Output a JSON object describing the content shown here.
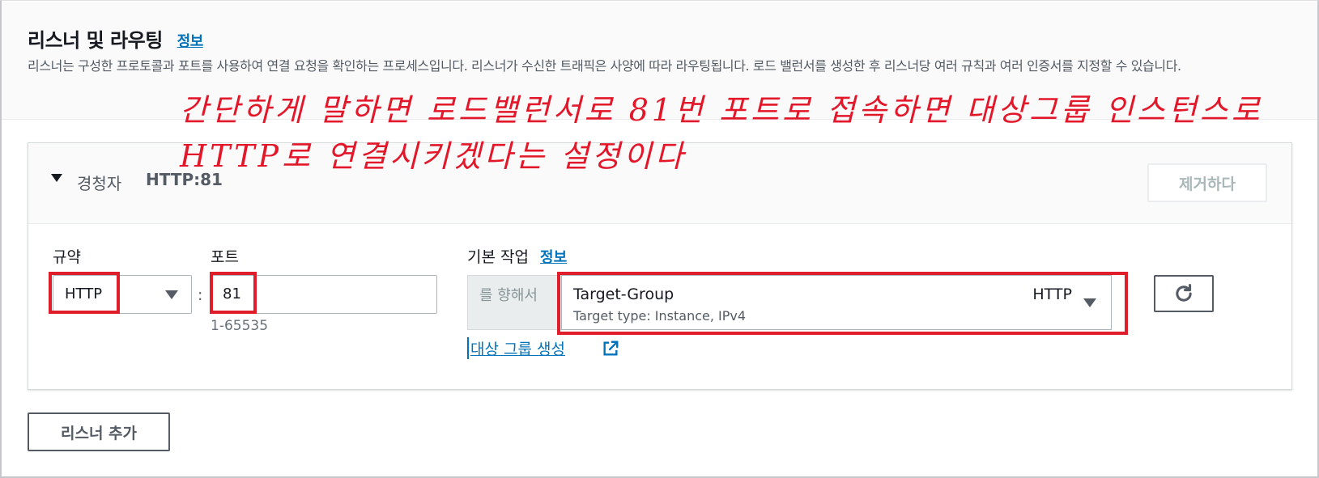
{
  "section": {
    "title": "리스너 및 라우팅",
    "info_link": "정보",
    "description": "리스너는 구성한 프로토콜과 포트를 사용하여 연결 요청을 확인하는 프로세스입니다. 리스너가 수신한 트래픽은 사양에 따라 라우팅됩니다. 로드 밸런서를 생성한 후 리스너당 여러 규칙과 여러 인증서를 지정할 수 있습니다."
  },
  "listener": {
    "header_label": "경청자",
    "header_value": "HTTP:81",
    "remove_button": "제거하다",
    "protocol_label": "규약",
    "protocol_value": "HTTP",
    "port_label": "포트",
    "port_value": "81",
    "port_hint": "1-65535",
    "default_action_label": "기본 작업",
    "default_action_info": "정보",
    "forward_prefix": "를 향해서",
    "target_group_name": "Target-Group",
    "target_group_sub": "Target type: Instance, IPv4",
    "target_group_protocol": "HTTP",
    "create_target_group_link": "대상 그룹 생성"
  },
  "add_listener_button": "리스너 추가",
  "annotation": {
    "line1": "간단하게 말하면 로드밸런서로 81번 포트로 접속하면 대상그룹 인스턴스로",
    "line2": "HTTP로 연결시키겠다는 설정이다",
    "color": "#e3172a"
  },
  "icons": {
    "toggle": "caret-down-icon",
    "refresh": "refresh-icon",
    "external": "external-link-icon"
  }
}
